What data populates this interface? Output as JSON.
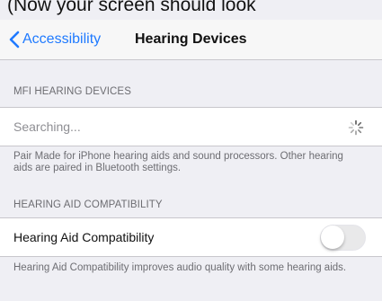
{
  "caption": "(Now your screen should look",
  "navbar": {
    "back_label": "Accessibility",
    "title": "Hearing Devices"
  },
  "sections": {
    "mfi": {
      "header": "MFI HEARING DEVICES",
      "status": "Searching...",
      "footer": "Pair Made for iPhone hearing aids and sound processors. Other hearing aids are paired in Bluetooth settings."
    },
    "hac": {
      "header": "HEARING AID COMPATIBILITY",
      "label": "Hearing Aid Compatibility",
      "toggle_on": false,
      "footer": "Hearing Aid Compatibility improves audio quality with some hearing aids."
    }
  },
  "colors": {
    "accent": "#1f7aff",
    "background": "#efeff4",
    "toggle_off": "#e9e9ea"
  },
  "icons": {
    "back": "chevron-left-icon",
    "activity": "spinner-icon"
  }
}
